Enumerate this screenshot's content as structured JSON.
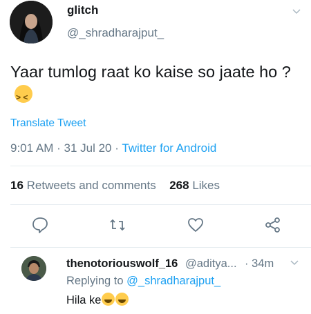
{
  "tweet": {
    "author_name": "glitch",
    "author_handle": "@_shradharajput_",
    "text": "Yaar tumlog raat ko kaise so jaate ho ?",
    "text_emoji": "tired-face-emoji",
    "translate_label": "Translate Tweet",
    "time": "9:01 AM",
    "date": "31 Jul 20",
    "source": "Twitter for Android",
    "retweets_count": "16",
    "retweets_label": "Retweets and comments",
    "likes_count": "268",
    "likes_label": "Likes"
  },
  "actions": {
    "reply_icon": "reply-icon",
    "retweet_icon": "retweet-icon",
    "like_icon": "heart-icon",
    "share_icon": "share-icon"
  },
  "reply": {
    "author_name": "thenotoriouswolf_16",
    "author_handle": "@aditya...",
    "time": "34m",
    "replying_prefix": "Replying to",
    "replying_to": "@_shradharajput_",
    "text": "Hila ke",
    "text_emojis": [
      "grinning-face-emoji",
      "grinning-face-emoji"
    ]
  },
  "colors": {
    "link_blue": "#1da1f2",
    "secondary_gray": "#657786",
    "text_dark": "#14171a"
  }
}
